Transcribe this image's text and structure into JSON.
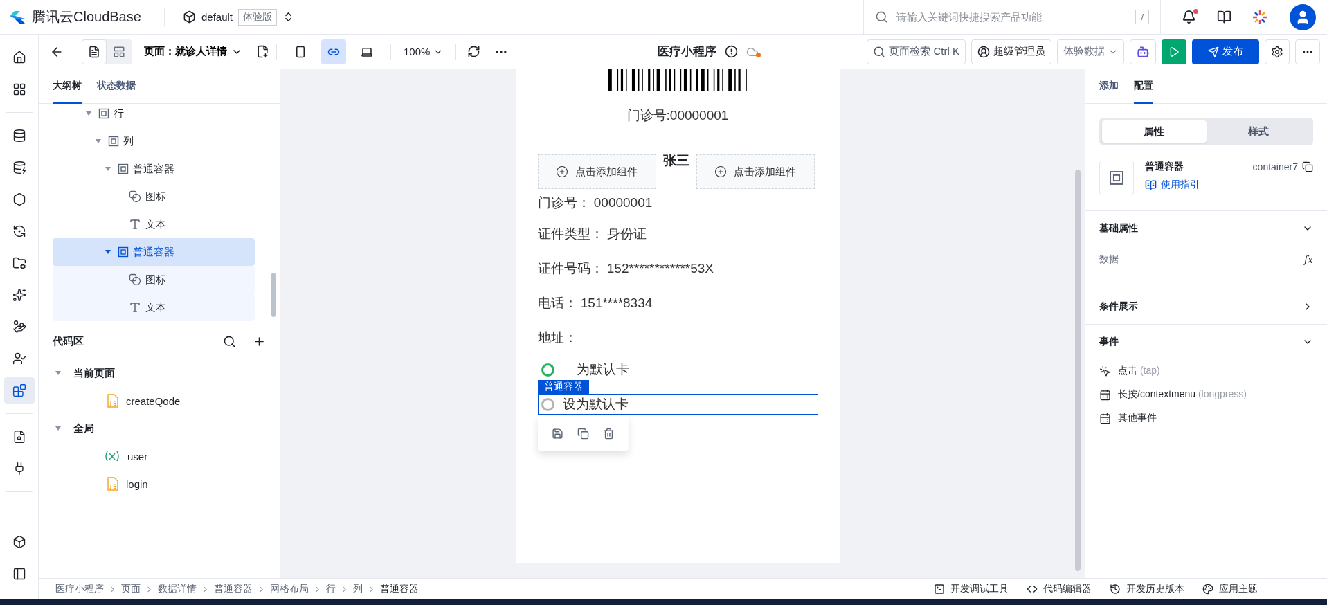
{
  "header": {
    "brand": "腾讯云CloudBase",
    "env_name": "default",
    "env_badge": "体验版",
    "search_placeholder": "请输入关键词快捷搜索产品功能",
    "search_key": "/",
    "has_notification": true
  },
  "rail": [
    {
      "kind": "home",
      "selected": false
    },
    {
      "kind": "grid",
      "selected": false
    },
    {
      "kind": "database",
      "selected": false
    },
    {
      "kind": "database-sync",
      "selected": false
    },
    {
      "kind": "hexagon",
      "selected": false
    },
    {
      "kind": "sync",
      "selected": false
    },
    {
      "kind": "folder",
      "selected": false
    },
    {
      "kind": "sparkle",
      "selected": false
    },
    {
      "kind": "hand",
      "selected": false
    },
    {
      "kind": "user",
      "selected": false
    },
    {
      "kind": "blocks",
      "selected": true
    },
    {
      "kind": "preview",
      "selected": false
    },
    {
      "kind": "plug",
      "selected": false
    },
    {
      "kind": "box",
      "selected": false
    },
    {
      "kind": "panel",
      "selected": false
    }
  ],
  "toolbar": {
    "layout_modes": [
      {
        "kind": "outline",
        "selected": true
      },
      {
        "kind": "layout",
        "selected": false
      }
    ],
    "page_label": "页面：就诊人详情",
    "view_modes": [
      {
        "kind": "mobile",
        "selected": false
      },
      {
        "kind": "miniprogram",
        "selected": true
      },
      {
        "kind": "desktop",
        "selected": false
      }
    ],
    "zoom": "100%",
    "app_title": "医疗小程序",
    "page_search": "页面检索",
    "page_search_key": "Ctrl K",
    "role": "超级管理员",
    "data_source": "体验数据",
    "publish": "发布"
  },
  "left_panel": {
    "tabs": [
      {
        "label": "大纲树",
        "selected": true
      },
      {
        "label": "状态数据",
        "selected": false
      }
    ],
    "tree": [
      {
        "kind": "container",
        "label": "行",
        "expanded": true,
        "selected": false,
        "children": [
          {
            "kind": "container",
            "label": "列",
            "expanded": true,
            "selected": false,
            "children": [
              {
                "kind": "container",
                "label": "普通容器",
                "expanded": true,
                "selected": false,
                "children": [
                  {
                    "kind": "icon",
                    "label": "图标",
                    "selected": false
                  },
                  {
                    "kind": "text",
                    "label": "文本",
                    "selected": false
                  }
                ]
              },
              {
                "kind": "container",
                "label": "普通容器",
                "expanded": true,
                "selected": true,
                "children": [
                  {
                    "kind": "icon",
                    "label": "图标",
                    "selected": false
                  },
                  {
                    "kind": "text",
                    "label": "文本",
                    "selected": false
                  }
                ]
              }
            ]
          }
        ]
      }
    ],
    "code_area": {
      "title": "代码区",
      "groups": [
        {
          "label": "当前页面",
          "expanded": true,
          "items": [
            {
              "kind": "js",
              "name": "createQode"
            }
          ]
        },
        {
          "label": "全局",
          "expanded": true,
          "items": [
            {
              "kind": "variable",
              "name": "user"
            },
            {
              "kind": "js",
              "name": "login"
            }
          ]
        }
      ]
    }
  },
  "canvas": {
    "outpatient_no": "门诊号:00000001",
    "patient_name": "张三",
    "add_slots": [
      "点击添加组件",
      "点击添加组件"
    ],
    "fields": [
      {
        "label": "门诊号：",
        "value": "00000001"
      },
      {
        "label": "证件类型：",
        "value": "身份证"
      },
      {
        "label": "证件号码：",
        "value": "152************53X"
      },
      {
        "label": "电话：",
        "value": "151****8334"
      },
      {
        "label": "地址："
      }
    ],
    "radios": [
      {
        "text": "为默认卡",
        "checked": true,
        "selected": false
      },
      {
        "text": "设为默认卡",
        "checked": false,
        "selected": true
      }
    ],
    "selection_tag": "普通容器"
  },
  "right_panel": {
    "tabs": [
      {
        "label": "添加",
        "selected": false
      },
      {
        "label": "配置",
        "selected": true
      }
    ],
    "segments": [
      {
        "label": "属性",
        "selected": true
      },
      {
        "label": "样式",
        "selected": false
      }
    ],
    "component": {
      "name": "普通容器",
      "id": "container7",
      "guide": "使用指引"
    },
    "sections": [
      {
        "title": "基础属性",
        "expanded": true,
        "fields": [
          {
            "label": "数据",
            "action": "fx"
          }
        ]
      },
      {
        "title": "条件展示",
        "expanded": false
      },
      {
        "title": "事件",
        "expanded": true,
        "events": [
          {
            "kind": "tap",
            "label": "点击",
            "hint": "(tap)"
          },
          {
            "kind": "calendar",
            "label": "长按/contextmenu",
            "hint": "(longpress)"
          },
          {
            "kind": "calendar",
            "label": "其他事件"
          }
        ]
      }
    ]
  },
  "bottom_bar": {
    "breadcrumb": [
      "医疗小程序",
      "页面",
      "数据详情",
      "普通容器",
      "网格布局",
      "行",
      "列",
      "普通容器"
    ],
    "tools": [
      {
        "kind": "debug",
        "label": "开发调试工具"
      },
      {
        "kind": "code",
        "label": "代码编辑器"
      },
      {
        "kind": "history",
        "label": "开发历史版本"
      },
      {
        "kind": "theme",
        "label": "应用主题"
      }
    ]
  }
}
